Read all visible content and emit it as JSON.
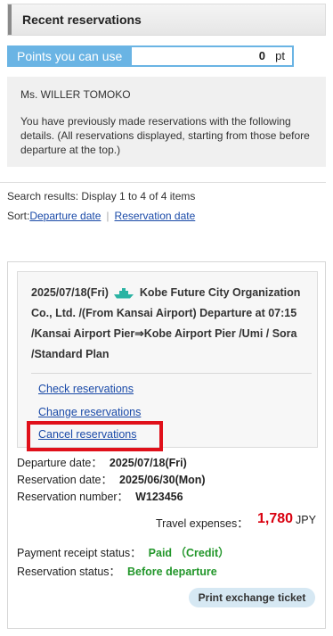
{
  "header": {
    "title": "Recent reservations"
  },
  "points": {
    "label": "Points you can use",
    "value": "0",
    "unit": "pt"
  },
  "info": {
    "name": "Ms.  WILLER TOMOKO",
    "message": "You have previously made reservations with the following details. (All reservations displayed, starting from those before departure at the top.)"
  },
  "results": {
    "summary": "Search results: Display 1 to 4 of 4 items",
    "sort_label": "Sort:",
    "sort_departure": "Departure date",
    "sort_separator": "|",
    "sort_reservation": "Reservation date"
  },
  "reservation": {
    "date": "2025/07/18(Fri)",
    "description": "Kobe Future City Organization Co., Ltd. /(From Kansai Airport) Departure at 07:15 /Kansai Airport Pier⇒Kobe Airport Pier /Umi / Sora /Standard Plan",
    "links": {
      "check": "Check reservations",
      "change": "Change reservations",
      "cancel": "Cancel reservations"
    },
    "departure_label": "Departure date：",
    "departure_value": "2025/07/18(Fri)",
    "reservation_label": "Reservation date：",
    "reservation_value": "2025/06/30(Mon)",
    "number_label": "Reservation number：",
    "number_value": "W123456",
    "expense_label": "Travel expenses：",
    "expense_value": "1,780",
    "expense_unit": "JPY",
    "payment_label": "Payment receipt status：",
    "payment_value": "Paid （Credit）",
    "status_label": "Reservation status：",
    "status_value": "Before departure",
    "print_button": "Print exchange ticket"
  },
  "colors": {
    "accent_blue": "#6ab4e4",
    "link": "#1a4aa8",
    "price_red": "#d9000f",
    "status_green": "#22962a",
    "highlight_red": "#e0101a"
  },
  "icons": {
    "ship": "ship-icon"
  }
}
